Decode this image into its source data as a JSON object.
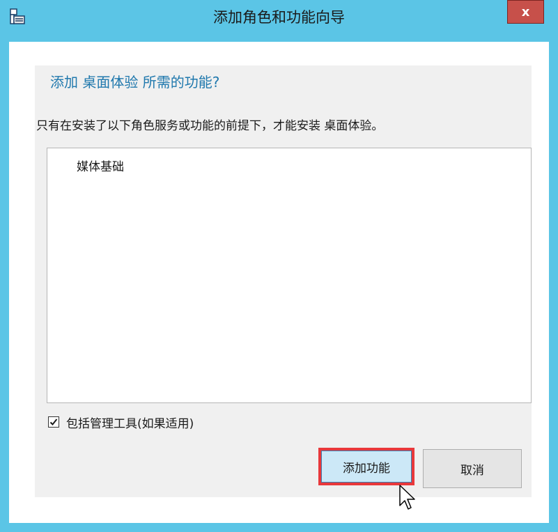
{
  "window": {
    "title": "添加角色和功能向导",
    "close_label": "x",
    "colors": {
      "frame": "#5bc5e6",
      "close": "#c7504a",
      "heading": "#1f78ad",
      "highlight": "#e8383b"
    }
  },
  "dialog": {
    "heading": "添加 桌面体验 所需的功能?",
    "description": "只有在安装了以下角色服务或功能的前提下，才能安装 桌面体验。",
    "features": [
      "媒体基础"
    ],
    "include_tools": {
      "label": "包括管理工具(如果适用)",
      "checked": true
    },
    "buttons": {
      "add": "添加功能",
      "cancel": "取消"
    }
  },
  "icons": {
    "app": "server-manager-icon",
    "check": "check-icon",
    "cursor": "mouse-pointer-icon"
  }
}
